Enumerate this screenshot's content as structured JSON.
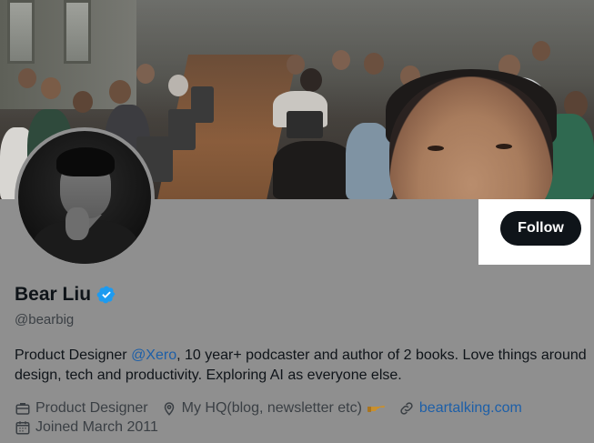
{
  "profile": {
    "display_name": "Bear Liu",
    "handle": "@bearbig",
    "verified": true,
    "follow_label": "Follow",
    "bio": {
      "prefix": "Product Designer ",
      "mention": "@Xero",
      "suffix": ", 10 year+ podcaster and author of 2 books. Love things around design, tech and productivity. Exploring AI as everyone else."
    },
    "meta": {
      "work": "Product Designer",
      "location": "My HQ(blog, newsletter etc)",
      "website": "beartalking.com",
      "joined": "Joined March 2011"
    }
  },
  "icons": {
    "verified": "verified-badge-icon",
    "work": "briefcase-icon",
    "location": "location-pin-icon",
    "pointing_hand": "pointing-hand-emoji-icon",
    "website": "link-icon",
    "joined": "calendar-icon"
  },
  "colors": {
    "button_bg": "#0f1419",
    "button_text": "#ffffff",
    "link": "#1d5fa8",
    "verified": "#1d9bf0",
    "overlay_bg": "#8f8f8f"
  }
}
